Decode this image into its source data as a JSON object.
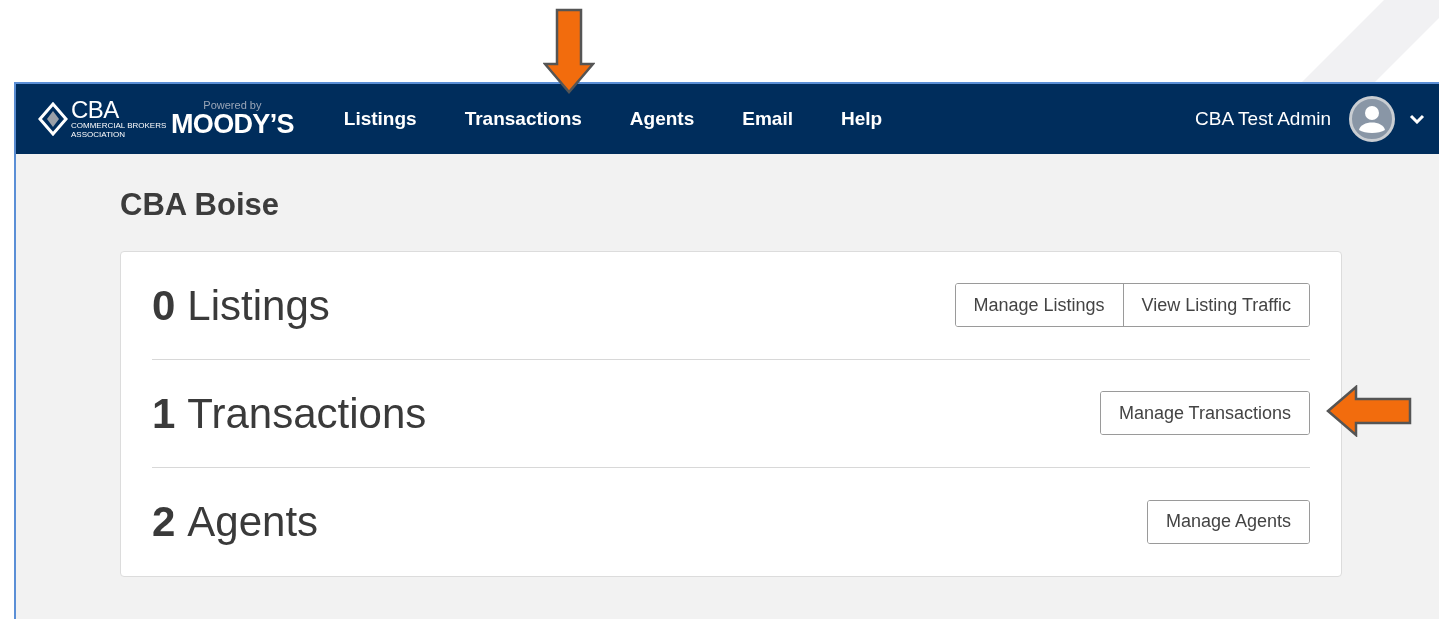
{
  "logo": {
    "mark": "CBA",
    "tagline": "COMMERCIAL BROKERS ASSOCIATION"
  },
  "powered_by": {
    "caption": "Powered by",
    "brand": "MOODY’S"
  },
  "nav": [
    "Listings",
    "Transactions",
    "Agents",
    "Email",
    "Help"
  ],
  "user": {
    "name": "CBA Test Admin"
  },
  "page_title": "CBA Boise",
  "stats": [
    {
      "count": "0",
      "label": "Listings",
      "buttons": [
        "Manage Listings",
        "View Listing Traffic"
      ]
    },
    {
      "count": "1",
      "label": "Transactions",
      "buttons": [
        "Manage Transactions"
      ]
    },
    {
      "count": "2",
      "label": "Agents",
      "buttons": [
        "Manage Agents"
      ]
    }
  ]
}
